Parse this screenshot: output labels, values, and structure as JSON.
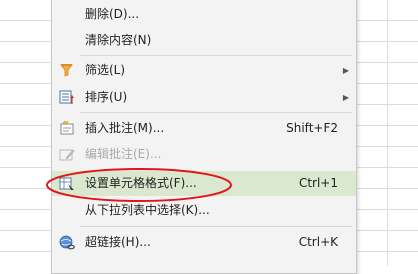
{
  "context_menu": {
    "items": [
      {
        "label": "删除(D)...",
        "icon": "",
        "shortcut": "",
        "submenu": false
      },
      {
        "label": "清除内容(N)",
        "icon": "",
        "shortcut": "",
        "submenu": false
      },
      {
        "label": "筛选(L)",
        "icon": "filter-icon",
        "shortcut": "",
        "submenu": true
      },
      {
        "label": "排序(U)",
        "icon": "sort-icon",
        "shortcut": "",
        "submenu": true
      },
      {
        "label": "插入批注(M)...",
        "icon": "insert-comment-icon",
        "shortcut": "Shift+F2",
        "submenu": false
      },
      {
        "label": "编辑批注(E)...",
        "icon": "edit-comment-icon",
        "shortcut": "",
        "submenu": false,
        "disabled": true
      },
      {
        "label": "设置单元格格式(F)...",
        "icon": "format-cells-icon",
        "shortcut": "Ctrl+1",
        "submenu": false,
        "highlighted": true
      },
      {
        "label": "从下拉列表中选择(K)...",
        "icon": "",
        "shortcut": "",
        "submenu": false
      },
      {
        "label": "超链接(H)...",
        "icon": "hyperlink-icon",
        "shortcut": "Ctrl+K",
        "submenu": false
      }
    ]
  },
  "annotation": {
    "color": "#e0161b"
  },
  "colors": {
    "highlight": "#dbe8d0",
    "menu_bg": "#f3f3f3"
  }
}
